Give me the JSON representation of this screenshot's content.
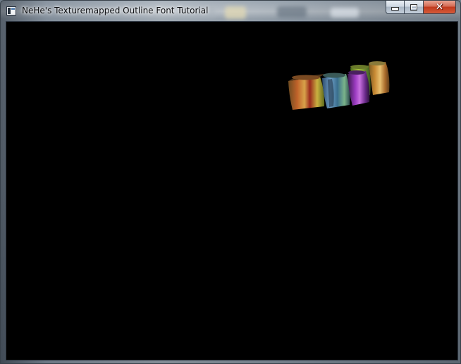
{
  "window": {
    "title": "NeHe's Texturemapped Outline Font Tutorial",
    "icon": "opengl-app-icon",
    "caption_buttons": [
      {
        "name": "minimize",
        "icon": "minimize-icon"
      },
      {
        "name": "maximize",
        "icon": "maximize-icon"
      },
      {
        "name": "close",
        "icon": "close-icon",
        "glyph": "✕"
      }
    ]
  },
  "viewport": {
    "background": "#000000",
    "scene": "rotating texture-mapped 3D outline font text"
  },
  "colors": {
    "frame": "#7c8894",
    "close_button": "#c8432a"
  }
}
